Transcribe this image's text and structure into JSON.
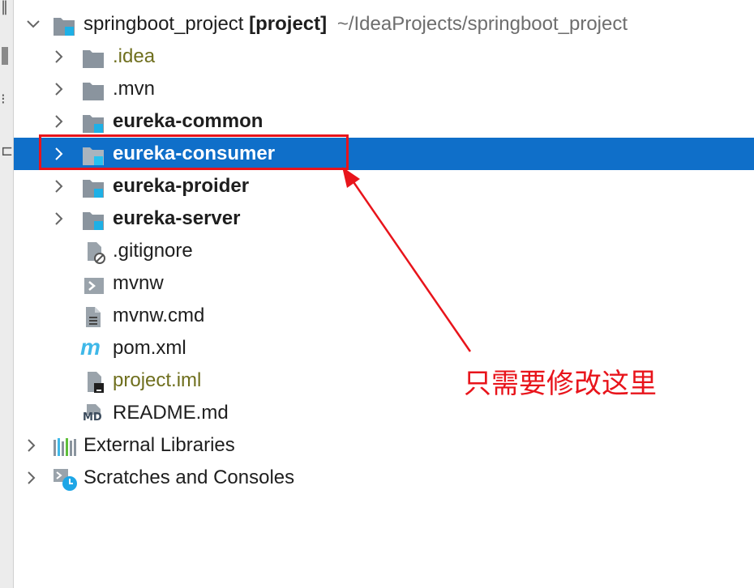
{
  "project": {
    "root_name": "springboot_project",
    "root_tag": "[project]",
    "root_path": "~/IdeaProjects/springboot_project"
  },
  "items": [
    {
      "label": ".idea"
    },
    {
      "label": ".mvn"
    },
    {
      "label": "eureka-common"
    },
    {
      "label": "eureka-consumer"
    },
    {
      "label": "eureka-proider"
    },
    {
      "label": "eureka-server"
    },
    {
      "label": ".gitignore"
    },
    {
      "label": "mvnw"
    },
    {
      "label": "mvnw.cmd"
    },
    {
      "label": "pom.xml",
      "icon_text": "m"
    },
    {
      "label": "project.iml"
    },
    {
      "label": "README.md",
      "icon_text": "MD"
    }
  ],
  "external_libraries": "External Libraries",
  "scratches": "Scratches and Consoles",
  "annotation": {
    "text": "只需要修改这里",
    "color": "#e8141b"
  },
  "colors": {
    "selection": "#0f6fc9",
    "module_badge": "#1eb0e6",
    "folder_gray": "#8a949e",
    "excluded_olive": "#6f6f1e"
  }
}
